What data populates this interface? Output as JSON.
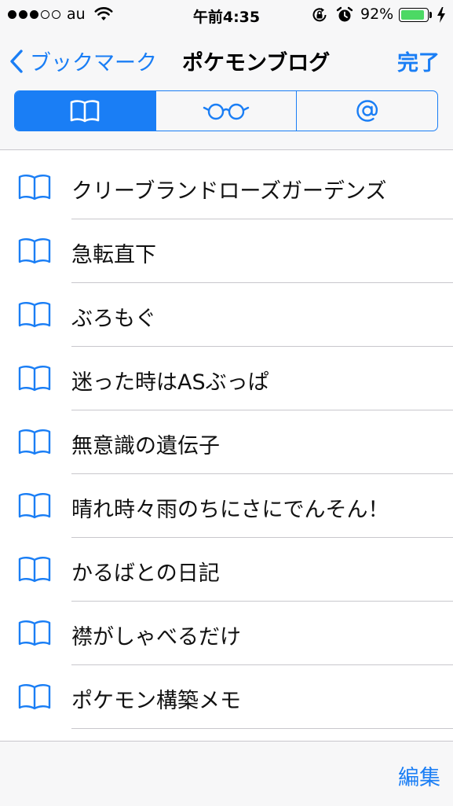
{
  "status_bar": {
    "carrier": "au",
    "time": "午前4:35",
    "battery_percent": "92%",
    "battery_level": 0.92,
    "signal_bars_filled": 3,
    "signal_bars_total": 5,
    "icons": [
      "signal-dots-icon",
      "wifi-icon",
      "rotation-lock-icon",
      "alarm-icon",
      "battery-icon",
      "charging-bolt-icon"
    ]
  },
  "nav": {
    "back_label": "ブックマーク",
    "title": "ポケモンブログ",
    "done_label": "完了"
  },
  "segments": [
    {
      "icon": "bookmarks-book-icon",
      "selected": true
    },
    {
      "icon": "reading-list-glasses-icon",
      "selected": false
    },
    {
      "icon": "shared-links-at-icon",
      "selected": false
    }
  ],
  "bookmarks": [
    {
      "icon": "bookmark-book-icon",
      "title": "クリーブランドローズガーデンズ"
    },
    {
      "icon": "bookmark-book-icon",
      "title": "急転直下"
    },
    {
      "icon": "bookmark-book-icon",
      "title": "ぶろもぐ"
    },
    {
      "icon": "bookmark-book-icon",
      "title": "迷った時はASぶっぱ"
    },
    {
      "icon": "bookmark-book-icon",
      "title": "無意識の遺伝子"
    },
    {
      "icon": "bookmark-book-icon",
      "title": "晴れ時々雨のちにさにでんそん！"
    },
    {
      "icon": "bookmark-book-icon",
      "title": "かるばとの日記"
    },
    {
      "icon": "bookmark-book-icon",
      "title": "襟がしゃべるだけ"
    },
    {
      "icon": "bookmark-book-icon",
      "title": "ポケモン構築メモ"
    }
  ],
  "toolbar": {
    "edit_label": "編集"
  },
  "colors": {
    "accent": "#1a7ef5",
    "battery": "#4cd964",
    "bar_background": "#f7f7f8",
    "separator": "#c8c7cc"
  }
}
